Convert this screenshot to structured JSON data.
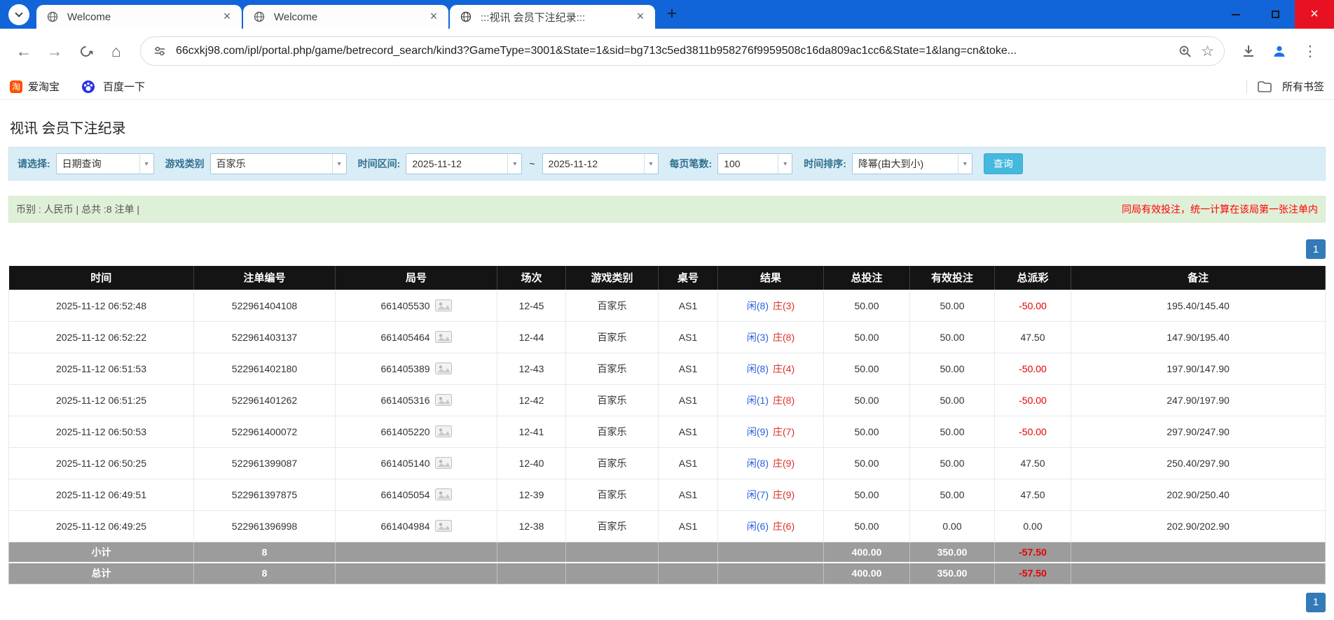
{
  "colors": {
    "titlebar": "#1165d9",
    "close_red": "#e81123",
    "accent_button": "#45b8de",
    "pagination_blue": "#337ab7",
    "header_bg": "#141414",
    "footer_bg": "#9c9c9c",
    "xian_blue": "#2b5fd9",
    "zhuang_red": "#d9302c",
    "link_blue": "#2e7cd6",
    "negative_red": "#e60000",
    "filter_bg": "#d9edf7",
    "summary_bg": "#dff0d8",
    "label_blue": "#31708f",
    "notice_red": "#ff0000"
  },
  "browser": {
    "tabs": [
      {
        "title": "Welcome"
      },
      {
        "title": "Welcome"
      },
      {
        "title": ":::视讯 会员下注纪录:::"
      }
    ],
    "new_tab": "+",
    "close_glyph": "×",
    "url": "66cxkj98.com/ipl/portal.php/game/betrecord_search/kind3?GameType=3001&State=1&sid=bg713c5ed3811b958276f9959508c16da809ac1cc6&State=1&lang=cn&toke...",
    "bookmarks": [
      {
        "label": "爱淘宝",
        "icon_letter": "淘"
      },
      {
        "label": "百度一下"
      }
    ],
    "bookmarks_right_label": "所有书签"
  },
  "page": {
    "title": "视讯 会员下注纪录",
    "filters": {
      "select_label": "请选择:",
      "select_value": "日期查询",
      "game_type_label": "游戏类别",
      "game_type_value": "百家乐",
      "date_range_label": "时间区间:",
      "date_from": "2025-11-12",
      "date_to": "2025-11-12",
      "range_separator": "~",
      "page_size_label": "每页笔数:",
      "page_size_value": "100",
      "sort_label": "时间排序:",
      "sort_value": "降幂(由大到小)",
      "search_button": "查询",
      "caret": "▼"
    },
    "summary": {
      "left": "币别 : 人民币 | 总共 :8 注单 |",
      "right": "同局有效投注，统一计算在该局第一张注单内"
    },
    "pagination": {
      "page": "1"
    },
    "table": {
      "headers": [
        "时间",
        "注单编号",
        "局号",
        "场次",
        "游戏类别",
        "桌号",
        "结果",
        "总投注",
        "有效投注",
        "总派彩",
        "备注"
      ],
      "rows": [
        {
          "time": "2025-11-12 06:52:48",
          "bet_id": "522961404108",
          "round": "661405530",
          "session": "12-45",
          "game": "百家乐",
          "table": "AS1",
          "xian": "闲(8)",
          "zhuang": "庄(3)",
          "total_bet": "50.00",
          "valid_bet": "50.00",
          "payout": "-50.00",
          "note": "195.40/145.40"
        },
        {
          "time": "2025-11-12 06:52:22",
          "bet_id": "522961403137",
          "round": "661405464",
          "session": "12-44",
          "game": "百家乐",
          "table": "AS1",
          "xian": "闲(3)",
          "zhuang": "庄(8)",
          "total_bet": "50.00",
          "valid_bet": "50.00",
          "payout": "47.50",
          "note": "147.90/195.40"
        },
        {
          "time": "2025-11-12 06:51:53",
          "bet_id": "522961402180",
          "round": "661405389",
          "session": "12-43",
          "game": "百家乐",
          "table": "AS1",
          "xian": "闲(8)",
          "zhuang": "庄(4)",
          "total_bet": "50.00",
          "valid_bet": "50.00",
          "payout": "-50.00",
          "note": "197.90/147.90"
        },
        {
          "time": "2025-11-12 06:51:25",
          "bet_id": "522961401262",
          "round": "661405316",
          "session": "12-42",
          "game": "百家乐",
          "table": "AS1",
          "xian": "闲(1)",
          "zhuang": "庄(8)",
          "total_bet": "50.00",
          "valid_bet": "50.00",
          "payout": "-50.00",
          "note": "247.90/197.90"
        },
        {
          "time": "2025-11-12 06:50:53",
          "bet_id": "522961400072",
          "round": "661405220",
          "session": "12-41",
          "game": "百家乐",
          "table": "AS1",
          "xian": "闲(9)",
          "zhuang": "庄(7)",
          "total_bet": "50.00",
          "valid_bet": "50.00",
          "payout": "-50.00",
          "note": "297.90/247.90"
        },
        {
          "time": "2025-11-12 06:50:25",
          "bet_id": "522961399087",
          "round": "661405140",
          "session": "12-40",
          "game": "百家乐",
          "table": "AS1",
          "xian": "闲(8)",
          "zhuang": "庄(9)",
          "total_bet": "50.00",
          "valid_bet": "50.00",
          "payout": "47.50",
          "note": "250.40/297.90"
        },
        {
          "time": "2025-11-12 06:49:51",
          "bet_id": "522961397875",
          "round": "661405054",
          "session": "12-39",
          "game": "百家乐",
          "table": "AS1",
          "xian": "闲(7)",
          "zhuang": "庄(9)",
          "total_bet": "50.00",
          "valid_bet": "50.00",
          "payout": "47.50",
          "note": "202.90/250.40"
        },
        {
          "time": "2025-11-12 06:49:25",
          "bet_id": "522961396998",
          "round": "661404984",
          "session": "12-38",
          "game": "百家乐",
          "table": "AS1",
          "xian": "闲(6)",
          "zhuang": "庄(6)",
          "total_bet": "50.00",
          "valid_bet": "0.00",
          "payout": "0.00",
          "note": "202.90/202.90"
        }
      ],
      "subtotal": {
        "label": "小计",
        "count": "8",
        "total_bet": "400.00",
        "valid_bet": "350.00",
        "payout": "-57.50"
      },
      "total": {
        "label": "总计",
        "count": "8",
        "total_bet": "400.00",
        "valid_bet": "350.00",
        "payout": "-57.50"
      }
    }
  }
}
